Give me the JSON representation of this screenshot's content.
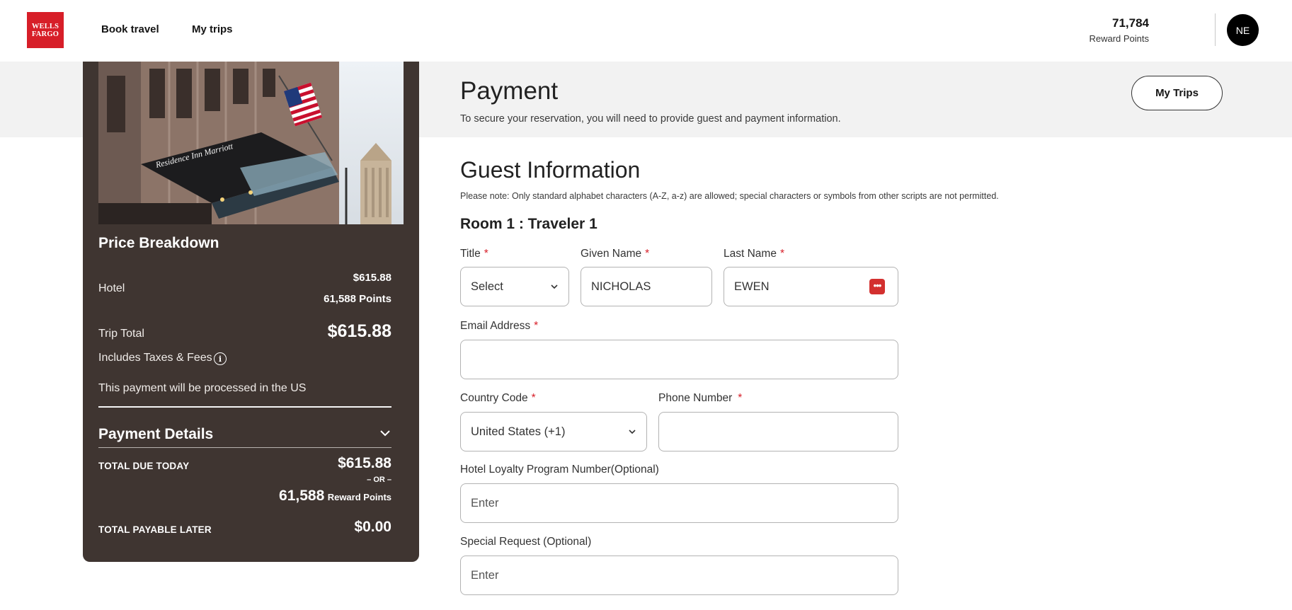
{
  "header": {
    "logo_line1": "WELLS",
    "logo_line2": "FARGO",
    "nav": [
      "Book travel",
      "My trips"
    ],
    "points_value": "71,784",
    "points_label": "Reward Points",
    "avatar_initials": "NE"
  },
  "summary": {
    "hotel_sign_text": "Residence Inn  Marriott",
    "price_breakdown_title": "Price Breakdown",
    "hotel_label": "Hotel",
    "hotel_price": "$615.88",
    "hotel_points": "61,588 Points",
    "trip_total_label": "Trip Total",
    "trip_total_value": "$615.88",
    "taxes_label": "Includes Taxes & Fees",
    "processed_note": "This payment will be processed in the US",
    "payment_details_title": "Payment Details",
    "total_due_label": "TOTAL DUE TODAY",
    "total_due_value": "$615.88",
    "or_label": "– OR –",
    "reward_points_value": "61,588",
    "reward_points_label": "Reward Points",
    "payable_later_label": "TOTAL PAYABLE LATER",
    "payable_later_value": "$0.00"
  },
  "main": {
    "title": "Payment",
    "subtitle": "To secure your reservation, you will need to provide guest and payment information.",
    "my_trips_button": "My Trips",
    "guest_title": "Guest Information",
    "note": "Please note: Only standard alphabet characters (A-Z, a-z) are allowed; special characters or symbols from other scripts are not permitted.",
    "room_title": "Room 1  :  Traveler 1",
    "form": {
      "title_label": "Title",
      "title_value": "Select",
      "given_name_label": "Given Name",
      "given_name_value": "NICHOLAS",
      "last_name_label": "Last Name",
      "last_name_value": "EWEN",
      "email_label": "Email Address",
      "email_value": "",
      "country_code_label": "Country Code",
      "country_code_value": "United States (+1)",
      "phone_label": "Phone Number",
      "phone_value": "",
      "loyalty_label": "Hotel Loyalty Program Number(Optional)",
      "loyalty_placeholder": "Enter",
      "special_label": "Special Request (Optional)",
      "special_placeholder": "Enter",
      "required_mark": "*"
    }
  },
  "colors": {
    "brand_red": "#d71e28",
    "card_bg": "#3f3531",
    "band_bg": "#f2f2f2"
  }
}
